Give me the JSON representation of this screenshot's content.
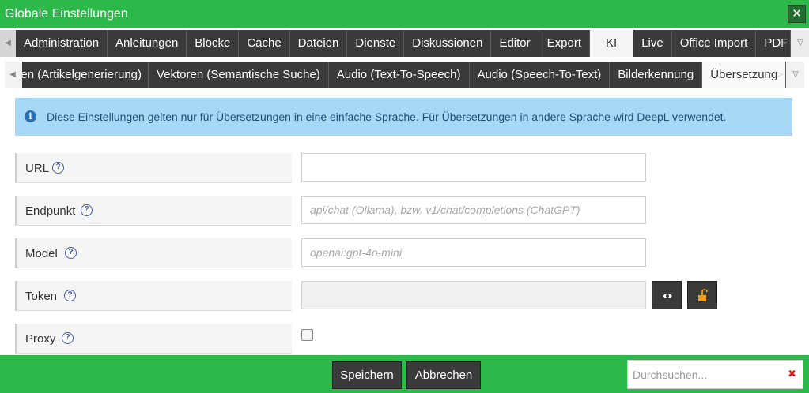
{
  "dialog": {
    "title": "Globale Einstellungen",
    "close_symbol": "✕"
  },
  "main_tabs": [
    {
      "label": "Administration"
    },
    {
      "label": "Anleitungen"
    },
    {
      "label": "Blöcke"
    },
    {
      "label": "Cache"
    },
    {
      "label": "Dateien"
    },
    {
      "label": "Dienste"
    },
    {
      "label": "Diskussionen"
    },
    {
      "label": "Editor"
    },
    {
      "label": "Export"
    },
    {
      "label": "KI",
      "active": true
    },
    {
      "label": "Live"
    },
    {
      "label": "Office Import"
    },
    {
      "label": "PDF"
    }
  ],
  "sub_tabs": [
    {
      "label": "Texten (Artikelgenerierung)"
    },
    {
      "label": "Vektoren (Semantische Suche)"
    },
    {
      "label": "Audio (Text-To-Speech)"
    },
    {
      "label": "Audio (Speech-To-Text)"
    },
    {
      "label": "Bilderkennung"
    },
    {
      "label": "Übersetzung",
      "active": true
    }
  ],
  "info": {
    "text": "Diese Einstellungen gelten nur für Übersetzungen in eine einfache Sprache. Für Übersetzungen in andere Sprache wird DeepL verwendet.",
    "icon": "info-icon"
  },
  "form": {
    "url": {
      "label": "URL",
      "value": "",
      "placeholder": ""
    },
    "endpoint": {
      "label": "Endpunkt",
      "value": "",
      "placeholder": "api/chat (Ollama), bzw. v1/chat/completions (ChatGPT)"
    },
    "model": {
      "label": "Model",
      "value": "",
      "placeholder": "openai:gpt-4o-mini"
    },
    "token": {
      "label": "Token",
      "value": ""
    },
    "proxy": {
      "label": "Proxy",
      "checked": false
    }
  },
  "help_symbol": "?",
  "footer": {
    "save_label": "Speichern",
    "cancel_label": "Abbrechen",
    "search_placeholder": "Durchsuchen...",
    "search_clear_symbol": "✖"
  },
  "colors": {
    "brand_green": "#2db84a",
    "tab_dark": "#3a3a3a",
    "info_bg": "#a7d8f6",
    "help_blue": "#3a56b0"
  }
}
